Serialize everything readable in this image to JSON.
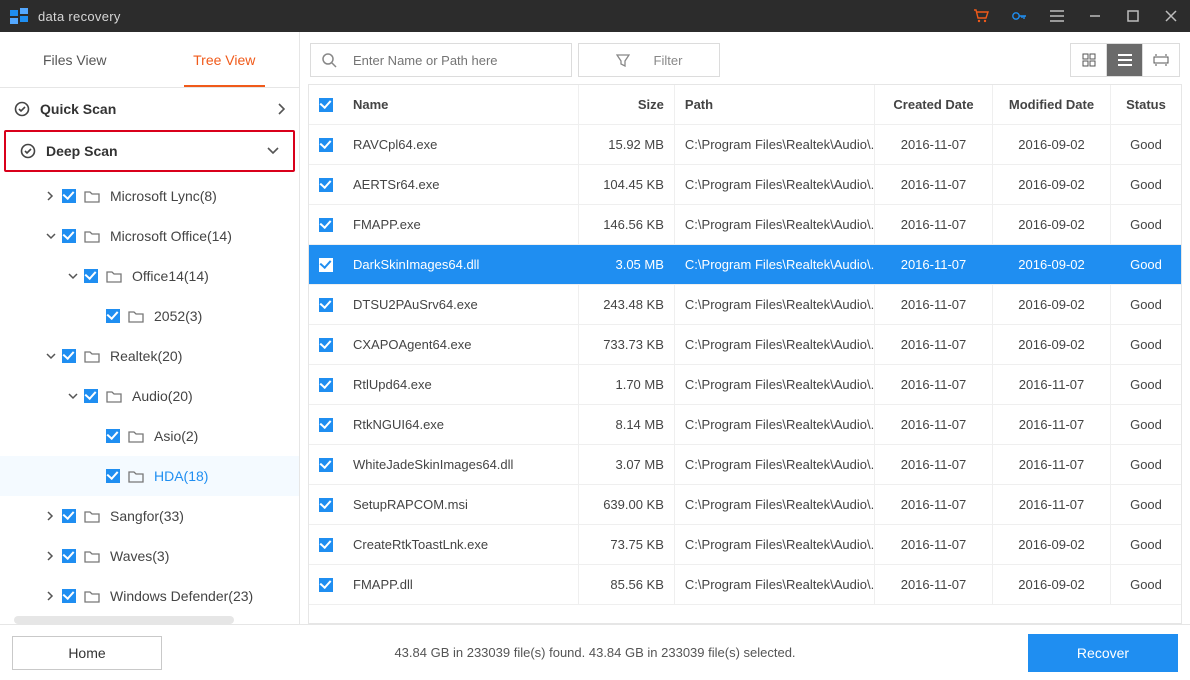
{
  "title": "data recovery",
  "colors": {
    "accent": "#f05a1a",
    "blue": "#1f8ef1",
    "titlebar": "#2c2c2c",
    "highlight": "#d9001b"
  },
  "sidebar_tabs": {
    "files": "Files View",
    "tree": "Tree View"
  },
  "quick_scan": "Quick Scan",
  "deep_scan": "Deep Scan",
  "tree_items": [
    {
      "label": "Microsoft Lync(8)",
      "indent": 1,
      "chev": "right",
      "active": false
    },
    {
      "label": "Microsoft Office(14)",
      "indent": 1,
      "chev": "down",
      "active": false
    },
    {
      "label": "Office14(14)",
      "indent": 2,
      "chev": "down",
      "active": false
    },
    {
      "label": "2052(3)",
      "indent": 3,
      "chev": "",
      "active": false
    },
    {
      "label": "Realtek(20)",
      "indent": 1,
      "chev": "down",
      "active": false
    },
    {
      "label": "Audio(20)",
      "indent": 2,
      "chev": "down",
      "active": false
    },
    {
      "label": "Asio(2)",
      "indent": 3,
      "chev": "",
      "active": false
    },
    {
      "label": "HDA(18)",
      "indent": 3,
      "chev": "",
      "active": true
    },
    {
      "label": "Sangfor(33)",
      "indent": 1,
      "chev": "right",
      "active": false
    },
    {
      "label": "Waves(3)",
      "indent": 1,
      "chev": "right",
      "active": false
    },
    {
      "label": "Windows Defender(23)",
      "indent": 1,
      "chev": "right",
      "active": false
    }
  ],
  "search_placeholder": "Enter Name or Path here",
  "filter_label": "Filter",
  "columns": {
    "name": "Name",
    "size": "Size",
    "path": "Path",
    "created": "Created Date",
    "modified": "Modified Date",
    "status": "Status"
  },
  "rows": [
    {
      "name": "RAVCpl64.exe",
      "size": "15.92 MB",
      "path": "C:\\Program Files\\Realtek\\Audio\\...",
      "cd": "2016-11-07",
      "md": "2016-09-02",
      "st": "Good",
      "sel": false
    },
    {
      "name": "AERTSr64.exe",
      "size": "104.45 KB",
      "path": "C:\\Program Files\\Realtek\\Audio\\...",
      "cd": "2016-11-07",
      "md": "2016-09-02",
      "st": "Good",
      "sel": false
    },
    {
      "name": "FMAPP.exe",
      "size": "146.56 KB",
      "path": "C:\\Program Files\\Realtek\\Audio\\...",
      "cd": "2016-11-07",
      "md": "2016-09-02",
      "st": "Good",
      "sel": false
    },
    {
      "name": "DarkSkinImages64.dll",
      "size": "3.05 MB",
      "path": "C:\\Program Files\\Realtek\\Audio\\...",
      "cd": "2016-11-07",
      "md": "2016-09-02",
      "st": "Good",
      "sel": true
    },
    {
      "name": "DTSU2PAuSrv64.exe",
      "size": "243.48 KB",
      "path": "C:\\Program Files\\Realtek\\Audio\\...",
      "cd": "2016-11-07",
      "md": "2016-09-02",
      "st": "Good",
      "sel": false
    },
    {
      "name": "CXAPOAgent64.exe",
      "size": "733.73 KB",
      "path": "C:\\Program Files\\Realtek\\Audio\\...",
      "cd": "2016-11-07",
      "md": "2016-09-02",
      "st": "Good",
      "sel": false
    },
    {
      "name": "RtlUpd64.exe",
      "size": "1.70 MB",
      "path": "C:\\Program Files\\Realtek\\Audio\\...",
      "cd": "2016-11-07",
      "md": "2016-11-07",
      "st": "Good",
      "sel": false
    },
    {
      "name": "RtkNGUI64.exe",
      "size": "8.14 MB",
      "path": "C:\\Program Files\\Realtek\\Audio\\...",
      "cd": "2016-11-07",
      "md": "2016-11-07",
      "st": "Good",
      "sel": false
    },
    {
      "name": "WhiteJadeSkinImages64.dll",
      "size": "3.07 MB",
      "path": "C:\\Program Files\\Realtek\\Audio\\...",
      "cd": "2016-11-07",
      "md": "2016-11-07",
      "st": "Good",
      "sel": false
    },
    {
      "name": "SetupRAPCOM.msi",
      "size": "639.00 KB",
      "path": "C:\\Program Files\\Realtek\\Audio\\...",
      "cd": "2016-11-07",
      "md": "2016-11-07",
      "st": "Good",
      "sel": false
    },
    {
      "name": "CreateRtkToastLnk.exe",
      "size": "73.75 KB",
      "path": "C:\\Program Files\\Realtek\\Audio\\...",
      "cd": "2016-11-07",
      "md": "2016-09-02",
      "st": "Good",
      "sel": false
    },
    {
      "name": "FMAPP.dll",
      "size": "85.56 KB",
      "path": "C:\\Program Files\\Realtek\\Audio\\...",
      "cd": "2016-11-07",
      "md": "2016-09-02",
      "st": "Good",
      "sel": false
    }
  ],
  "footer": {
    "home": "Home",
    "status": "43.84 GB in 233039 file(s) found.   43.84 GB in 233039 file(s) selected.",
    "recover": "Recover"
  }
}
